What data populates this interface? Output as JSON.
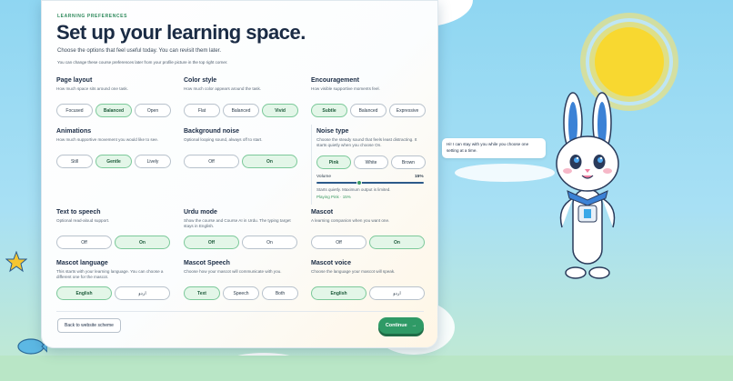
{
  "header": {
    "eyebrow": "LEARNING PREFERENCES",
    "title": "Set up your learning space.",
    "subtitle": "Choose the options that feel useful today. You can revisit them later.",
    "note": "You can change these course preferences later from your profile picture in the top right corner."
  },
  "sections": {
    "page_layout": {
      "title": "Page layout",
      "desc": "How much space sits around one task.",
      "options": [
        "Focused",
        "Balanced",
        "Open"
      ],
      "selected": "Balanced"
    },
    "color_style": {
      "title": "Color style",
      "desc": "How much color appears around the task.",
      "options": [
        "Flat",
        "Balanced",
        "Vivid"
      ],
      "selected": "Vivid"
    },
    "encouragement": {
      "title": "Encouragement",
      "desc": "How visible supportive moments feel.",
      "options": [
        "Subtle",
        "Balanced",
        "Expressive"
      ],
      "selected": "Subtle"
    },
    "animations": {
      "title": "Animations",
      "desc": "How much supportive movement you would like to see.",
      "options": [
        "Still",
        "Gentle",
        "Lively"
      ],
      "selected": "Gentle"
    },
    "background_noise": {
      "title": "Background noise",
      "desc": "Optional looping sound, always off to start.",
      "options": [
        "Off",
        "On"
      ],
      "selected": "On"
    },
    "noise_type": {
      "title": "Noise type",
      "desc": "Choose the steady sound that feels least distracting. It starts quietly when you choose On.",
      "options": [
        "Pink",
        "White",
        "Brown"
      ],
      "selected": "Pink"
    },
    "text_to_speech": {
      "title": "Text to speech",
      "desc": "Optional read-aloud support.",
      "options": [
        "Off",
        "On"
      ],
      "selected": "On"
    },
    "urdu_mode": {
      "title": "Urdu mode",
      "desc": "Show the course and Course AI in Urdu. The typing target stays in English.",
      "options": [
        "Off",
        "On"
      ],
      "selected": "Off"
    },
    "mascot": {
      "title": "Mascot",
      "desc": "A learning companion when you want one.",
      "options": [
        "Off",
        "On"
      ],
      "selected": "On"
    },
    "mascot_language": {
      "title": "Mascot language",
      "desc": "This starts with your learning language. You can choose a different one for the mascot.",
      "options": [
        "English",
        "اردو"
      ],
      "selected": "English"
    },
    "mascot_speech": {
      "title": "Mascot Speech",
      "desc": "Choose how your mascot will communicate with you.",
      "options": [
        "Text",
        "Speech",
        "Both"
      ],
      "selected": "Text"
    },
    "mascot_voice": {
      "title": "Mascot voice",
      "desc": "Choose the language your mascot will speak.",
      "options": [
        "English",
        "اردو"
      ],
      "selected": "English"
    }
  },
  "volume": {
    "label": "Volume",
    "value_text": "15%",
    "value": 0.15,
    "hint": "Starts quietly. Maximum output is limited.",
    "playing": "Playing Pink · 15%"
  },
  "footer": {
    "back_label": "Back to website scheme",
    "continue_label": "Continue",
    "continue_arrow": "→"
  },
  "mascot_bubble": "Hi! I can stay with you while you choose one setting at a time.",
  "colors": {
    "accent": "#2f9a66",
    "selected_bg": "#e3f6e8",
    "title": "#1a2b44",
    "sky": "#8fd6f2",
    "sun": "#f8d830"
  }
}
